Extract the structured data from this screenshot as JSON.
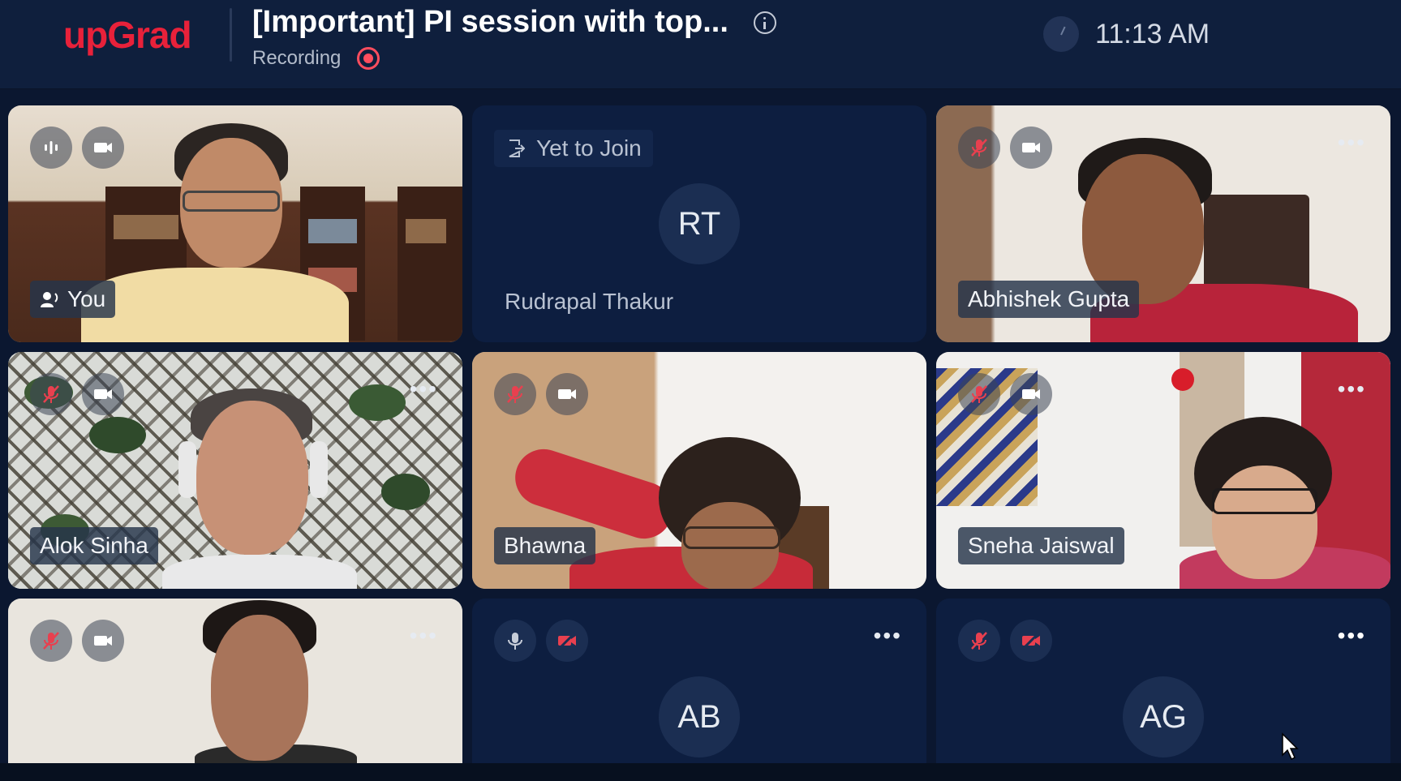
{
  "header": {
    "logo": "upGrad",
    "title": "[Important] PI session with top...",
    "recording_label": "Recording",
    "time": "11:13 AM"
  },
  "colors": {
    "brand": "#e8213a",
    "background": "#0b1730",
    "header": "#0f1f3d",
    "tile": "#0d1e40",
    "recording": "#ff4d5e",
    "muted_icon": "#e8404f"
  },
  "tiles": [
    {
      "name": "You",
      "type": "video",
      "mic": "speaking",
      "camera": "on"
    },
    {
      "name": "Rudrapal Thakur",
      "type": "avatar",
      "initials": "RT",
      "status": "Yet to Join"
    },
    {
      "name": "Abhishek Gupta",
      "type": "video",
      "mic": "muted",
      "camera": "on"
    },
    {
      "name": "Alok Sinha",
      "type": "video",
      "mic": "muted",
      "camera": "on"
    },
    {
      "name": "Bhawna",
      "type": "video",
      "mic": "muted",
      "camera": "on"
    },
    {
      "name": "Sneha Jaiswal",
      "type": "video",
      "mic": "muted",
      "camera": "on"
    },
    {
      "name": "",
      "type": "video",
      "mic": "muted",
      "camera": "on"
    },
    {
      "name": "",
      "type": "avatar",
      "initials": "AB",
      "mic": "on",
      "camera": "off"
    },
    {
      "name": "",
      "type": "avatar",
      "initials": "AG",
      "mic": "muted",
      "camera": "off"
    }
  ],
  "icons": {
    "info": "info-icon",
    "clock": "clock-icon",
    "mic": "microphone-icon",
    "mic_muted": "microphone-muted-icon",
    "camera": "camera-icon",
    "camera_off": "camera-off-icon",
    "more": "more-options-icon",
    "join": "exit-door-icon",
    "speaker": "speaking-user-icon"
  }
}
